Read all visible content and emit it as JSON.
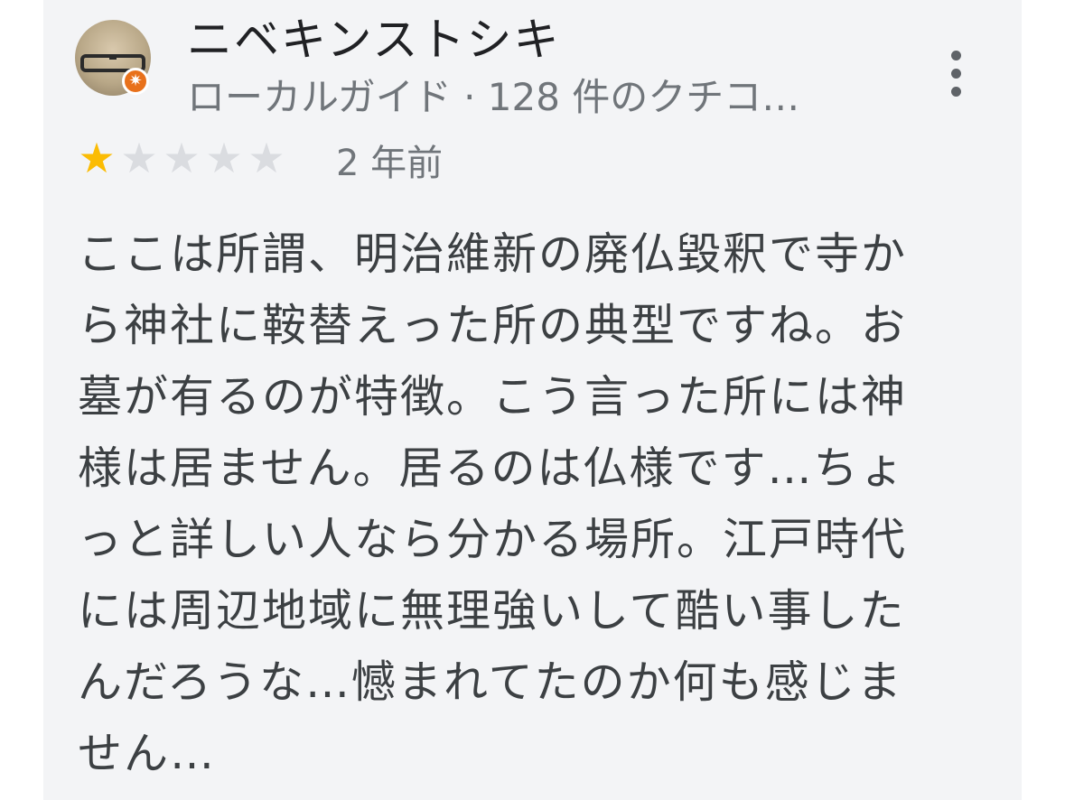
{
  "review": {
    "author_name": "ニベキンストシキ",
    "author_meta": "ローカルガイド · 128 件のクチコ…",
    "rating": 1,
    "max_rating": 5,
    "date": "2 年前",
    "text_lines": [
      "ここは所謂、明治維新の廃仏毀釈で寺か",
      "ら神社に鞍替えった所の典型ですね。お",
      "墓が有るのが特徴。こう言った所には神",
      "様は居ません。居るのは仏様です…ちょ",
      "っと詳しい人なら分かる場所。江戸時代",
      "には周辺地域に無理強いして酷い事した",
      "んだろうな…憾まれてたのか何も感じま",
      "せん…"
    ]
  },
  "icons": {
    "avatar": "avatar-photo-glasses",
    "badge": "local-guide-badge-icon",
    "more": "more-vert-icon",
    "star_filled": "star-filled-icon",
    "star_empty": "star-empty-icon"
  },
  "colors": {
    "card_background": "#f3f4f6",
    "star_filled": "#fbbc04",
    "star_empty": "#dadce0",
    "badge": "#e8711b",
    "name_text": "#202124",
    "meta_text": "#70757a",
    "body_text": "#3c4043"
  }
}
